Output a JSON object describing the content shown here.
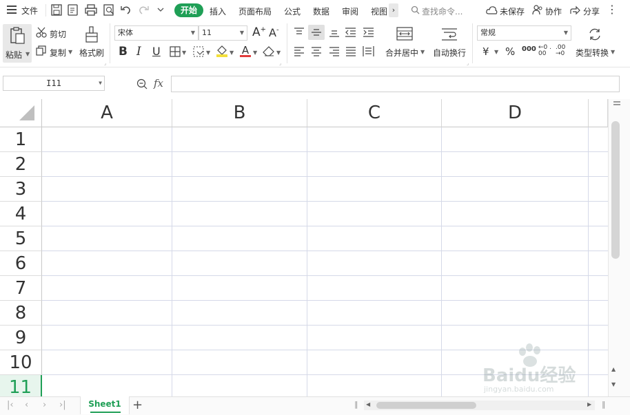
{
  "menu": {
    "file_label": "文件",
    "tabs": [
      "开始",
      "插入",
      "页面布局",
      "公式",
      "数据",
      "审阅",
      "视图"
    ],
    "search_placeholder": "查找命令...",
    "unsaved": "未保存",
    "collab": "协作",
    "share": "分享"
  },
  "ribbon": {
    "paste": "粘贴",
    "cut": "剪切",
    "copy": "复制",
    "format_painter": "格式刷",
    "font_name": "宋体",
    "font_size": "11",
    "merge_center": "合并居中",
    "wrap_text": "自动换行",
    "number_format": "常规",
    "convert_type": "类型转换",
    "bold": "B",
    "italic": "I",
    "underline": "U",
    "font_color_letter": "A",
    "grow_font": "A⁺",
    "shrink_font": "A⁻",
    "currency": "¥",
    "percent": "%",
    "thousands": "000",
    "inc_decimal": "←0 .00",
    "dec_decimal": ".00 →0"
  },
  "formula_bar": {
    "name_box": "I11",
    "fx": "fx",
    "value": ""
  },
  "sheet": {
    "columns": [
      "A",
      "B",
      "C",
      "D"
    ],
    "rows": [
      "1",
      "2",
      "3",
      "4",
      "5",
      "6",
      "7",
      "8",
      "9",
      "10",
      "11"
    ],
    "active_row": "11"
  },
  "tabs_bar": {
    "sheet_name": "Sheet1",
    "add": "+"
  },
  "watermark": {
    "brand": "Baidu经验",
    "url": "jingyan.baidu.com"
  },
  "colors": {
    "accent": "#1f9f56",
    "grid_line": "#d5d9e8"
  }
}
